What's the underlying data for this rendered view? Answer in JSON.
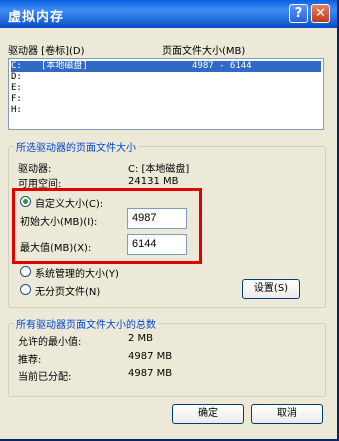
{
  "window": {
    "title": "虚拟内存",
    "help_button": "?",
    "close_button": "✕"
  },
  "drive_list": {
    "col_drive_label": "驱动器 [卷标](D)",
    "col_pagefile_label": "页面文件大小(MB)",
    "rows": [
      {
        "drive": "C:",
        "volume": "[本地磁盘]",
        "size": "4987 - 6144",
        "selected": true
      },
      {
        "drive": "D:",
        "volume": "",
        "size": "",
        "selected": false
      },
      {
        "drive": "E:",
        "volume": "",
        "size": "",
        "selected": false
      },
      {
        "drive": "F:",
        "volume": "",
        "size": "",
        "selected": false
      },
      {
        "drive": "H:",
        "volume": "",
        "size": "",
        "selected": false
      }
    ]
  },
  "selected_drive": {
    "group_title": "所选驱动器的页面文件大小",
    "drive_label": "驱动器:",
    "drive_value": "C: [本地磁盘]",
    "free_label": "可用空间:",
    "free_value": "24131 MB",
    "custom_size_label": "自定义大小(C):",
    "initial_size_label": "初始大小(MB)(I):",
    "initial_size_value": "4987",
    "max_size_label": "最大值(MB)(X):",
    "max_size_value": "6144",
    "system_managed_label": "系统管理的大小(Y)",
    "no_paging_label": "无分页文件(N)",
    "set_button": "设置(S)"
  },
  "totals": {
    "group_title": "所有驱动器页面文件大小的总数",
    "min_label": "允许的最小值:",
    "min_value": "2 MB",
    "recommended_label": "推荐:",
    "recommended_value": "4987 MB",
    "current_label": "当前已分配:",
    "current_value": "4987 MB"
  },
  "footer": {
    "ok_button": "确定",
    "cancel_button": "取消"
  },
  "colors": {
    "title_bar": "#0a5fe0",
    "highlight": "#e00000",
    "group_title": "#0046d5",
    "selection": "#316ac5"
  }
}
